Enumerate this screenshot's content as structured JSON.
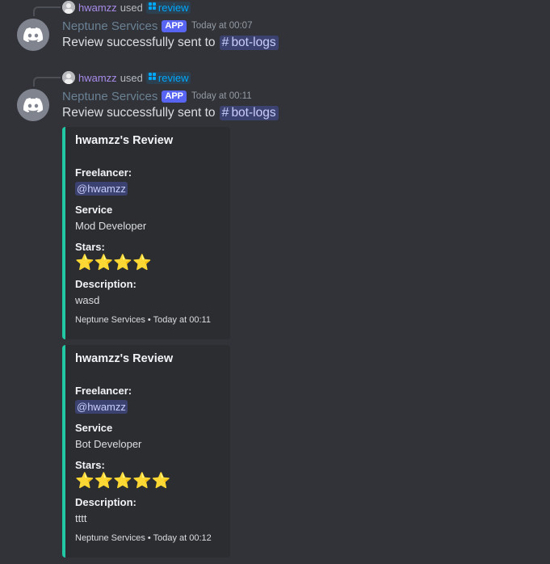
{
  "messages": [
    {
      "reply": {
        "user": "hwamzz",
        "used": "used",
        "command": "review"
      },
      "bot_name": "Neptune Services",
      "app_tag": "APP",
      "timestamp": "Today at 00:07",
      "content": "Review successfully sent to",
      "channel": "bot-logs"
    },
    {
      "reply": {
        "user": "hwamzz",
        "used": "used",
        "command": "review"
      },
      "bot_name": "Neptune Services",
      "app_tag": "APP",
      "timestamp": "Today at 00:11",
      "content": "Review successfully sent to",
      "channel": "bot-logs",
      "embeds": [
        {
          "title": "hwamzz's Review",
          "freelancer_label": "Freelancer:",
          "freelancer": "@hwamzz",
          "service_label": "Service",
          "service": "Mod Developer",
          "stars_label": "Stars:",
          "stars": "⭐⭐⭐⭐",
          "stars_count": 4,
          "description_label": "Description:",
          "description": "wasd",
          "footer": "Neptune Services • Today at 00:11"
        },
        {
          "title": "hwamzz's Review",
          "freelancer_label": "Freelancer:",
          "freelancer": "@hwamzz",
          "service_label": "Service",
          "service": "Bot Developer",
          "stars_label": "Stars:",
          "stars": "⭐⭐⭐⭐⭐",
          "stars_count": 5,
          "description_label": "Description:",
          "description": "tttt",
          "footer": "Neptune Services • Today at 00:12"
        }
      ]
    }
  ],
  "colors": {
    "background": "#323339",
    "embed_bar": "#22c8a4",
    "app_tag": "#5865f2",
    "command": "#00a8fc",
    "star": "#ffac33"
  },
  "icons": {
    "avatar": "discord-logo-icon",
    "command": "slash-command-icon",
    "channel": "hash-icon",
    "star": "star-icon"
  }
}
